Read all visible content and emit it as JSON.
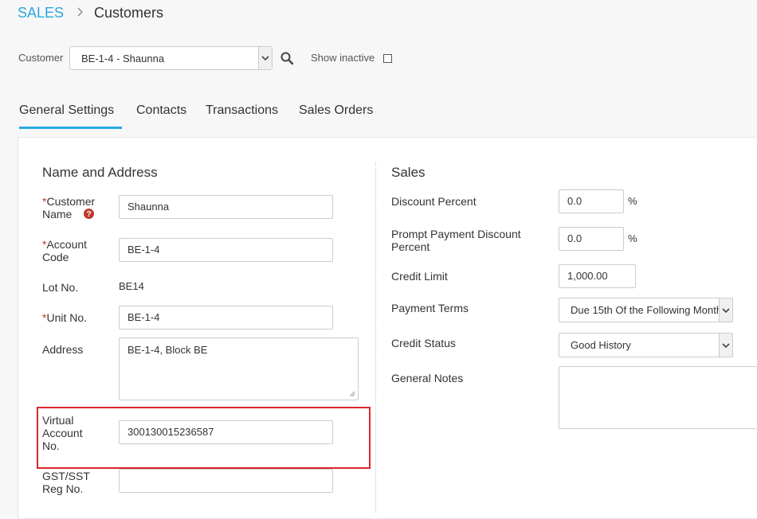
{
  "breadcrumb": {
    "module": "SALES",
    "page": "Customers"
  },
  "customer_bar": {
    "label": "Customer",
    "selected": "BE-1-4 - Shaunna",
    "show_inactive_label": "Show inactive",
    "show_inactive_checked": false
  },
  "tabs": [
    {
      "label": "General Settings",
      "active": true
    },
    {
      "label": "Contacts",
      "active": false
    },
    {
      "label": "Transactions",
      "active": false
    },
    {
      "label": "Sales Orders",
      "active": false
    }
  ],
  "name_address": {
    "title": "Name and Address",
    "customer_name": {
      "required": "*",
      "label_line1": "Customer",
      "label_line2": "Name",
      "value": "Shaunna"
    },
    "account_code": {
      "required": "*",
      "label_line1": "Account",
      "label_line2": "Code",
      "value": "BE-1-4"
    },
    "lot_no": {
      "label": "Lot No.",
      "value": "BE14"
    },
    "unit_no": {
      "required": "*",
      "label": "Unit No.",
      "value": "BE-1-4"
    },
    "address": {
      "label": "Address",
      "value": "BE-1-4, Block BE"
    },
    "virtual_account": {
      "label_line1": "Virtual",
      "label_line2": "Account",
      "label_line3": "No.",
      "value": "300130015236587"
    },
    "gst_reg": {
      "label_line1": "GST/SST",
      "label_line2": "Reg No.",
      "value": ""
    }
  },
  "sales": {
    "title": "Sales",
    "discount_percent": {
      "label": "Discount Percent",
      "value": "0.0",
      "unit": "%"
    },
    "prompt_payment": {
      "label_line1": "Prompt Payment Discount",
      "label_line2": "Percent",
      "value": "0.0",
      "unit": "%"
    },
    "credit_limit": {
      "label": "Credit Limit",
      "value": "1,000.00"
    },
    "payment_terms": {
      "label": "Payment Terms",
      "value": "Due 15th Of the Following Month"
    },
    "credit_status": {
      "label": "Credit Status",
      "value": "Good History"
    },
    "general_notes": {
      "label": "General Notes",
      "value": ""
    }
  },
  "colors": {
    "accent": "#27a9e1",
    "highlight": "#d9262f",
    "required": "#c0392b"
  }
}
